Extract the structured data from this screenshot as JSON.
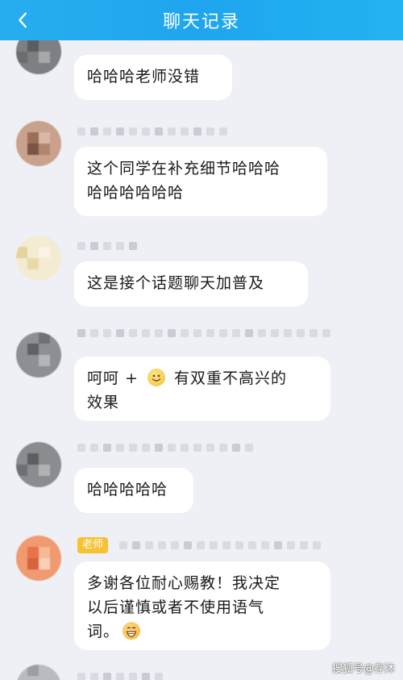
{
  "header": {
    "title": "聊天记录"
  },
  "messages": [
    {
      "lines": [
        "哈哈哈老师没错"
      ]
    },
    {
      "lines": [
        "这个同学在补充细节哈哈哈",
        "哈哈哈哈哈哈"
      ]
    },
    {
      "lines": [
        "这是接个话题聊天加普及"
      ]
    },
    {
      "line1_before": "呵呵 + ",
      "line1_after": " 有双重不高兴的",
      "line2": "效果"
    },
    {
      "lines": [
        "哈哈哈哈哈"
      ]
    },
    {
      "role": "老师",
      "lines": [
        "多谢各位耐心赐教！我决定",
        "以后谨慎或者不使用语气"
      ],
      "line3_before": "词。"
    }
  ],
  "watermark": "搜狐号@存沐",
  "icons": {
    "back": "chevron-left-icon",
    "smile": "smile-emoji-icon",
    "grin": "grin-emoji-icon"
  },
  "colors": {
    "header": "#1ea5ee",
    "background": "#eef0f5",
    "bubble": "#ffffff",
    "role_tag": "#f6c232"
  }
}
